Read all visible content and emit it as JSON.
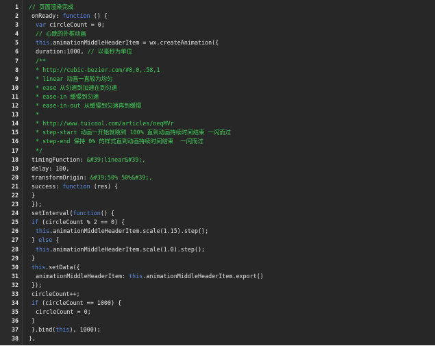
{
  "editor": {
    "colors": {
      "background": "#272727",
      "gutter": "#2b2b2b",
      "keyword": "#5a8ee8",
      "comment": "#43d15a",
      "string": "#50d060",
      "plain": "#e6e6e6"
    },
    "lines": [
      {
        "n": "1",
        "tokens": [
          {
            "t": "comment",
            "v": "// 页面渲染完成"
          }
        ]
      },
      {
        "n": "2",
        "tokens": [
          {
            "t": "plain",
            "v": "onReady: "
          },
          {
            "t": "kw",
            "v": "function"
          },
          {
            "t": "plain",
            "v": " () {"
          }
        ]
      },
      {
        "n": "3",
        "tokens": [
          {
            "t": "kw",
            "v": "var"
          },
          {
            "t": "plain",
            "v": " circleCount = 0;"
          }
        ]
      },
      {
        "n": "4",
        "tokens": [
          {
            "t": "comment",
            "v": "// 心跳的外框动画"
          }
        ]
      },
      {
        "n": "5",
        "tokens": [
          {
            "t": "kw",
            "v": "this"
          },
          {
            "t": "plain",
            "v": ".animationMiddleHeaderItem = wx.createAnimation({"
          }
        ]
      },
      {
        "n": "6",
        "tokens": [
          {
            "t": "plain",
            "v": "duration:1000, "
          },
          {
            "t": "comment",
            "v": "// 以毫秒为单位"
          }
        ]
      },
      {
        "n": "7",
        "tokens": [
          {
            "t": "comment",
            "v": "/**"
          }
        ]
      },
      {
        "n": "8",
        "tokens": [
          {
            "t": "comment",
            "v": "* http://cubic-bezier.com/#0,0,.58,1"
          }
        ]
      },
      {
        "n": "9",
        "tokens": [
          {
            "t": "comment",
            "v": "* linear 动画一直较为均匀"
          }
        ]
      },
      {
        "n": "10",
        "tokens": [
          {
            "t": "comment",
            "v": "* ease 从匀速到加速在到匀速"
          }
        ]
      },
      {
        "n": "11",
        "tokens": [
          {
            "t": "comment",
            "v": "* ease-in 缓慢到匀速"
          }
        ]
      },
      {
        "n": "12",
        "tokens": [
          {
            "t": "comment",
            "v": "* ease-in-out 从缓慢到匀速再到缓慢"
          }
        ]
      },
      {
        "n": "13",
        "tokens": [
          {
            "t": "comment",
            "v": "*"
          }
        ]
      },
      {
        "n": "14",
        "tokens": [
          {
            "t": "comment",
            "v": "* http://www.tuicool.com/articles/neqMVr"
          }
        ]
      },
      {
        "n": "15",
        "tokens": [
          {
            "t": "comment",
            "v": "* step-start 动画一开始就跳到 100% 直到动画持续时间结束 一闪而过"
          }
        ]
      },
      {
        "n": "16",
        "tokens": [
          {
            "t": "comment",
            "v": "* step-end 保持 0% 的样式直到动画持续时间结束  一闪而过"
          }
        ]
      },
      {
        "n": "17",
        "tokens": [
          {
            "t": "comment",
            "v": "*/"
          }
        ]
      },
      {
        "n": "18",
        "tokens": [
          {
            "t": "plain",
            "v": "timingFunction: "
          },
          {
            "t": "str",
            "v": "&#39;linear&#39;,"
          }
        ]
      },
      {
        "n": "19",
        "tokens": [
          {
            "t": "plain",
            "v": "delay: 100,"
          }
        ]
      },
      {
        "n": "20",
        "tokens": [
          {
            "t": "plain",
            "v": "transformOrigin: "
          },
          {
            "t": "str",
            "v": "&#39;50% 50%&#39;,"
          }
        ]
      },
      {
        "n": "21",
        "tokens": [
          {
            "t": "plain",
            "v": "success: "
          },
          {
            "t": "kw",
            "v": "function"
          },
          {
            "t": "plain",
            "v": " (res) {"
          }
        ]
      },
      {
        "n": "22",
        "tokens": [
          {
            "t": "plain",
            "v": "}"
          }
        ]
      },
      {
        "n": "23",
        "tokens": [
          {
            "t": "plain",
            "v": "});"
          }
        ]
      },
      {
        "n": "24",
        "tokens": [
          {
            "t": "plain",
            "v": "setInterval("
          },
          {
            "t": "kw",
            "v": "function"
          },
          {
            "t": "plain",
            "v": "() {"
          }
        ]
      },
      {
        "n": "25",
        "tokens": [
          {
            "t": "kw",
            "v": "if"
          },
          {
            "t": "plain",
            "v": " (circleCount % 2 == 0) {"
          }
        ]
      },
      {
        "n": "26",
        "tokens": [
          {
            "t": "kw",
            "v": "this"
          },
          {
            "t": "plain",
            "v": ".animationMiddleHeaderItem.scale(1.15).step();"
          }
        ]
      },
      {
        "n": "27",
        "tokens": [
          {
            "t": "plain",
            "v": "} "
          },
          {
            "t": "kw",
            "v": "else"
          },
          {
            "t": "plain",
            "v": " {"
          }
        ]
      },
      {
        "n": "28",
        "tokens": [
          {
            "t": "kw",
            "v": "this"
          },
          {
            "t": "plain",
            "v": ".animationMiddleHeaderItem.scale(1.0).step();"
          }
        ]
      },
      {
        "n": "29",
        "tokens": [
          {
            "t": "plain",
            "v": "}"
          }
        ]
      },
      {
        "n": "30",
        "tokens": [
          {
            "t": "kw",
            "v": "this"
          },
          {
            "t": "plain",
            "v": ".setData({"
          }
        ]
      },
      {
        "n": "31",
        "tokens": [
          {
            "t": "plain",
            "v": "animationMiddleHeaderItem: "
          },
          {
            "t": "kw",
            "v": "this"
          },
          {
            "t": "plain",
            "v": ".animationMiddleHeaderItem.export()"
          }
        ]
      },
      {
        "n": "32",
        "tokens": [
          {
            "t": "plain",
            "v": "});"
          }
        ]
      },
      {
        "n": "33",
        "tokens": [
          {
            "t": "plain",
            "v": "circleCount++;"
          }
        ]
      },
      {
        "n": "34",
        "tokens": [
          {
            "t": "kw",
            "v": "if"
          },
          {
            "t": "plain",
            "v": " (circleCount == 1000) {"
          }
        ]
      },
      {
        "n": "35",
        "tokens": [
          {
            "t": "plain",
            "v": "circleCount = 0;"
          }
        ]
      },
      {
        "n": "36",
        "tokens": [
          {
            "t": "plain",
            "v": "}"
          }
        ]
      },
      {
        "n": "37",
        "tokens": [
          {
            "t": "plain",
            "v": "}.bind("
          },
          {
            "t": "kw",
            "v": "this"
          },
          {
            "t": "plain",
            "v": "), 1000);"
          }
        ]
      },
      {
        "n": "38",
        "tokens": [
          {
            "t": "plain",
            "v": "},"
          }
        ]
      }
    ]
  }
}
